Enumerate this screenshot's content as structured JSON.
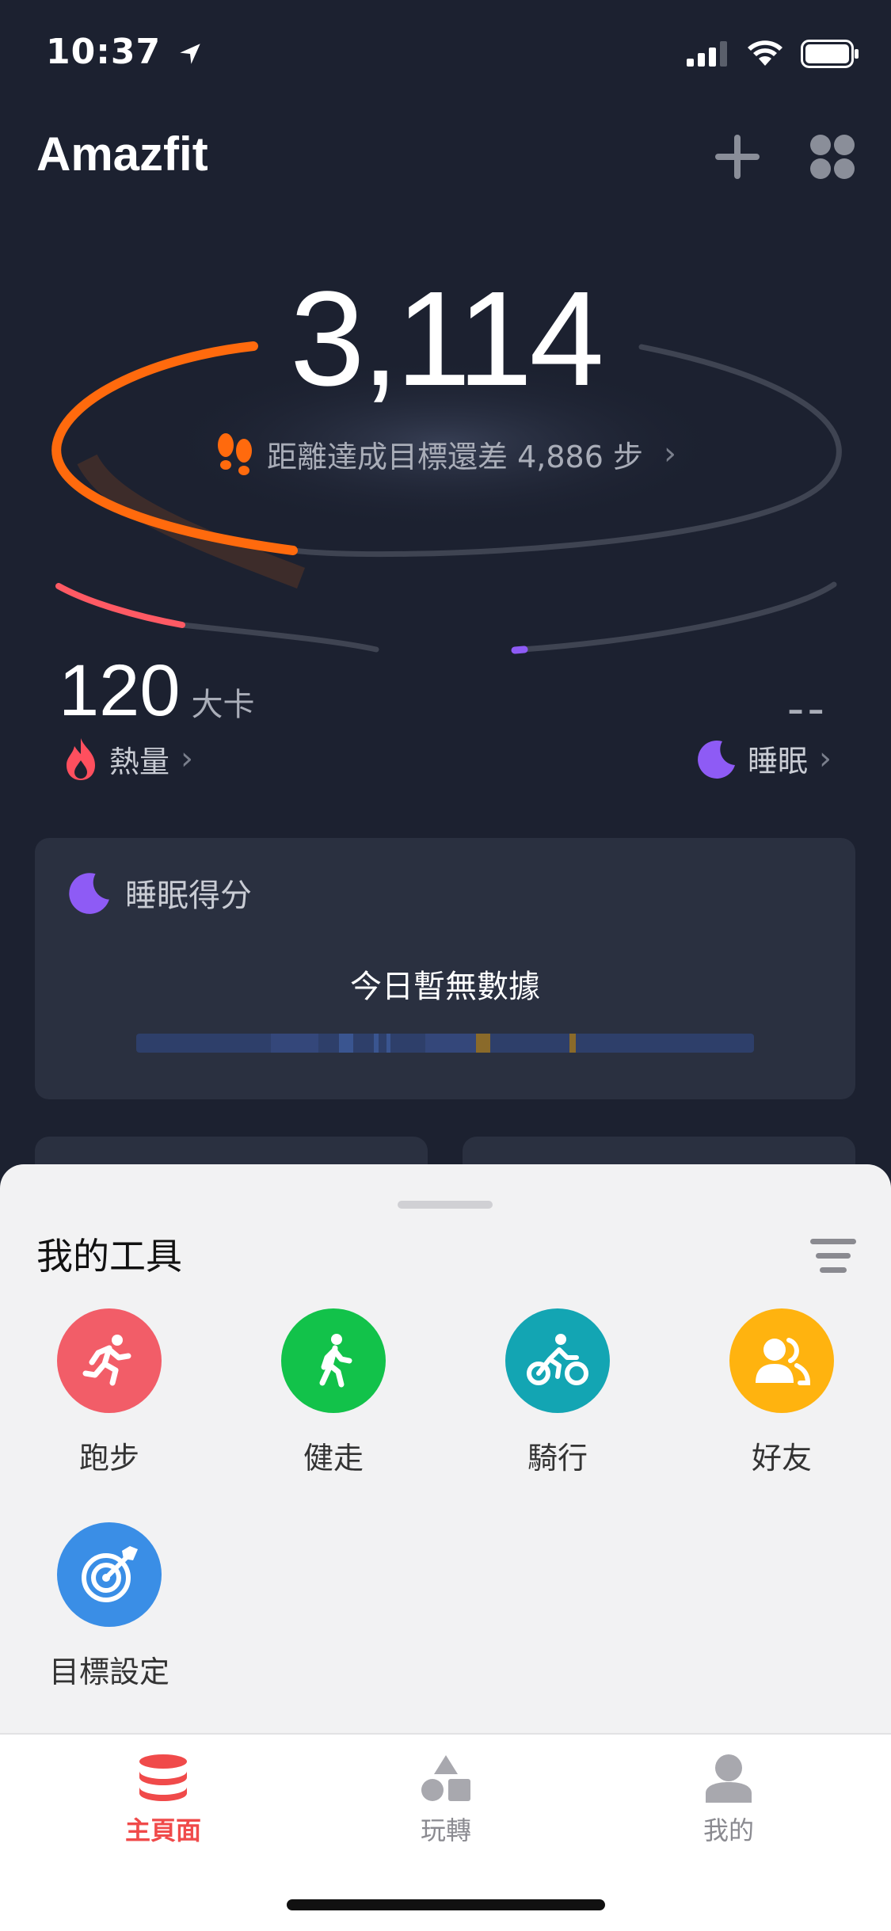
{
  "status": {
    "time": "10:37"
  },
  "header": {
    "brand": "Amazfit"
  },
  "summary": {
    "steps": "3,114",
    "goal_text": "距離達成目標還差 4,886 步",
    "calories_value": "120",
    "calories_unit": "大卡",
    "calories_label": "熱量",
    "sleep_value": "--",
    "sleep_label": "睡眠"
  },
  "sleep_card": {
    "title": "睡眠得分",
    "no_data": "今日暫無數據"
  },
  "tools": {
    "title": "我的工具",
    "items": [
      {
        "label": "跑步",
        "color": "#f25d68"
      },
      {
        "label": "健走",
        "color": "#12c24a"
      },
      {
        "label": "騎行",
        "color": "#13a5b3"
      },
      {
        "label": "好友",
        "color": "#ffb30f"
      },
      {
        "label": "目標設定",
        "color": "#3a8ee6"
      }
    ]
  },
  "tabbar": {
    "tabs": [
      {
        "label": "主頁面",
        "active": true,
        "color": "#f04a4a"
      },
      {
        "label": "玩轉",
        "active": false
      },
      {
        "label": "我的",
        "active": false
      }
    ]
  },
  "colors": {
    "background": "#1c2130",
    "steps_arc": "#ff6a0d",
    "calorie_arc": "#ff5a64",
    "sleep_arc": "#8e5bf5"
  }
}
